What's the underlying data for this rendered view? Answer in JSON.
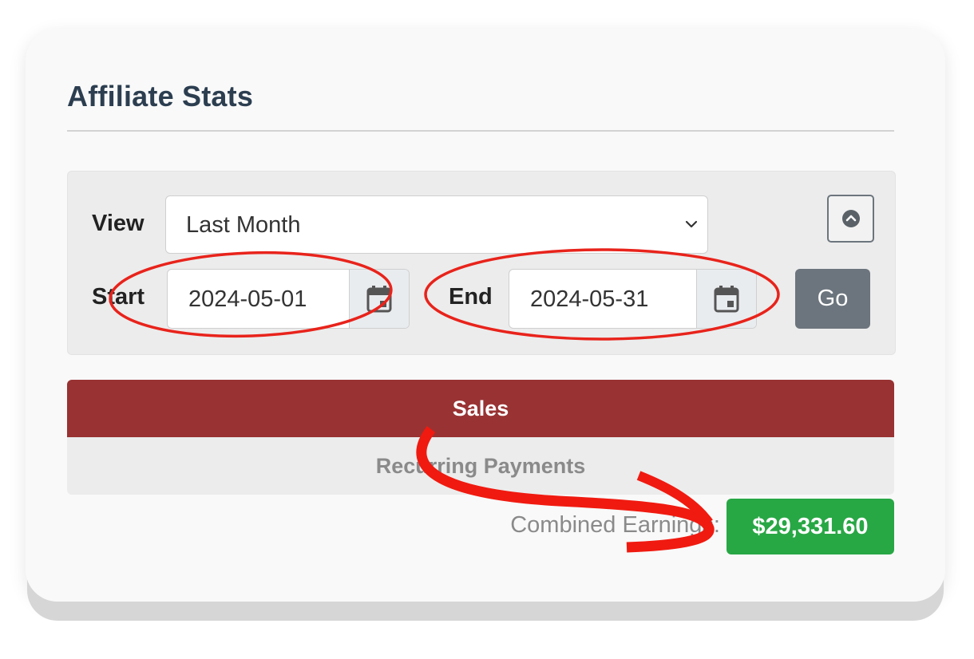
{
  "panel": {
    "title": "Affiliate Stats"
  },
  "filters": {
    "view_label": "View",
    "view_selected": "Last Month",
    "start_label": "Start",
    "start_value": "2024-05-01",
    "end_label": "End",
    "end_value": "2024-05-31",
    "go_label": "Go"
  },
  "tabs": [
    {
      "label": "Sales",
      "active": true
    },
    {
      "label": "Recurring Payments",
      "active": false
    }
  ],
  "earnings": {
    "label": "Combined Earnings:",
    "value": "$29,331.60"
  },
  "colors": {
    "active_tab": "#993233",
    "earnings_badge": "#28a745",
    "go_button": "#6c757d",
    "annotation": "#e8231b"
  },
  "icons": [
    "chevron-down-icon",
    "collapse-up-icon",
    "calendar-icon",
    "calendar-icon"
  ]
}
